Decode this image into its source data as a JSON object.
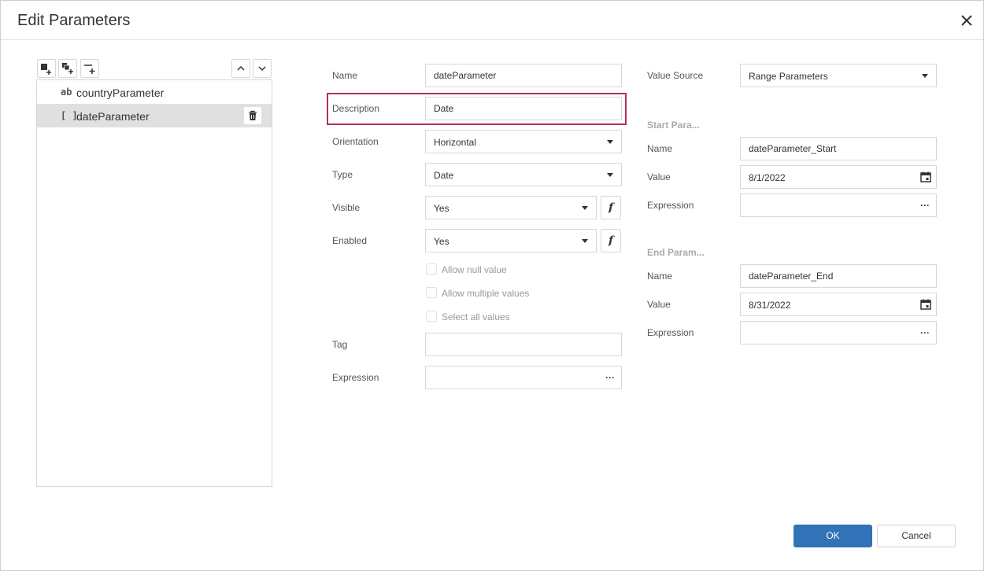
{
  "dialog": {
    "title": "Edit Parameters"
  },
  "toolbar": {
    "icons": [
      "add-parameter-icon",
      "add-multiple-parameters-icon",
      "add-separator-icon",
      "move-up-icon",
      "move-down-icon"
    ]
  },
  "parameters": [
    {
      "icon": "ab",
      "label": "countryParameter",
      "selected": false
    },
    {
      "icon": "[ ]",
      "label": "dateParameter",
      "selected": true
    }
  ],
  "form": {
    "name_label": "Name",
    "name_value": "dateParameter",
    "description_label": "Description",
    "description_value": "Date",
    "orientation_label": "Orientation",
    "orientation_value": "Horizontal",
    "type_label": "Type",
    "type_value": "Date",
    "visible_label": "Visible",
    "visible_value": "Yes",
    "enabled_label": "Enabled",
    "enabled_value": "Yes",
    "allow_null_label": "Allow null value",
    "allow_multiple_label": "Allow multiple values",
    "select_all_label": "Select all values",
    "tag_label": "Tag",
    "tag_value": "",
    "expression_label": "Expression",
    "expression_value": "",
    "fx_symbol": "f"
  },
  "value_source": {
    "label": "Value Source",
    "value": "Range Parameters"
  },
  "start_param": {
    "title": "Start Para...",
    "name_label": "Name",
    "name_value": "dateParameter_Start",
    "value_label": "Value",
    "value_value": "8/1/2022",
    "expression_label": "Expression",
    "expression_value": ""
  },
  "end_param": {
    "title": "End Param...",
    "name_label": "Name",
    "name_value": "dateParameter_End",
    "value_label": "Value",
    "value_value": "8/31/2022",
    "expression_label": "Expression",
    "expression_value": ""
  },
  "buttons": {
    "ok": "OK",
    "cancel": "Cancel",
    "ellipsis": "···"
  },
  "colors": {
    "accent": "#3272b6",
    "highlight": "#b1334f",
    "selected_row": "#e0e0e0"
  }
}
